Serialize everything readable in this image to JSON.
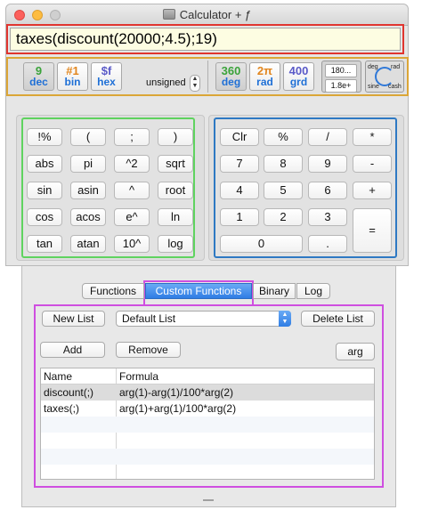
{
  "window": {
    "title": "Calculator + ƒ"
  },
  "expression": "taxes(discount(20000;4.5);19)",
  "mode_bar": {
    "base_buttons": [
      {
        "top": "9",
        "bottom": "dec",
        "color": "green"
      },
      {
        "top": "#1",
        "bottom": "bin",
        "color": "orange"
      },
      {
        "top": "$f",
        "bottom": "hex",
        "color": "blue"
      }
    ],
    "signedness": "unsigned",
    "angle_buttons": [
      {
        "top": "360",
        "bottom": "deg",
        "color": "green"
      },
      {
        "top": "2π",
        "bottom": "rad",
        "color": "orange"
      },
      {
        "top": "400",
        "bottom": "grd",
        "color": "purple"
      }
    ],
    "precision": [
      "180...",
      "1.8e+"
    ],
    "angle_toggle": {
      "deg": "deg",
      "rad": "rad",
      "sine": "sine",
      "cash": "cash"
    }
  },
  "function_keys": [
    "!%",
    "(",
    ";",
    ")",
    "abs",
    "pi",
    "^2",
    "sqrt",
    "sin",
    "asin",
    "^",
    "root",
    "cos",
    "acos",
    "e^",
    "ln",
    "tan",
    "atan",
    "10^",
    "log"
  ],
  "number_keys": {
    "row1": [
      "Clr",
      "%",
      "/",
      "*"
    ],
    "row2": [
      "7",
      "8",
      "9",
      "-"
    ],
    "row3": [
      "4",
      "5",
      "6",
      "+"
    ],
    "row4": [
      "1",
      "2",
      "3"
    ],
    "row5": [
      "0",
      "."
    ],
    "equals": "="
  },
  "tabs": [
    "Functions",
    "Custom Functions",
    "Binary",
    "Log"
  ],
  "active_tab": "Custom Functions",
  "custom": {
    "new_list": "New List",
    "list_select": "Default List",
    "delete_list": "Delete List",
    "add": "Add",
    "remove": "Remove",
    "arg": "arg",
    "columns": [
      "Name",
      "Formula"
    ],
    "rows": [
      {
        "name": "discount(;)",
        "formula": "arg(1)-arg(1)/100*arg(2)"
      },
      {
        "name": "taxes(;)",
        "formula": "arg(1)+arg(1)/100*arg(2)"
      }
    ]
  }
}
